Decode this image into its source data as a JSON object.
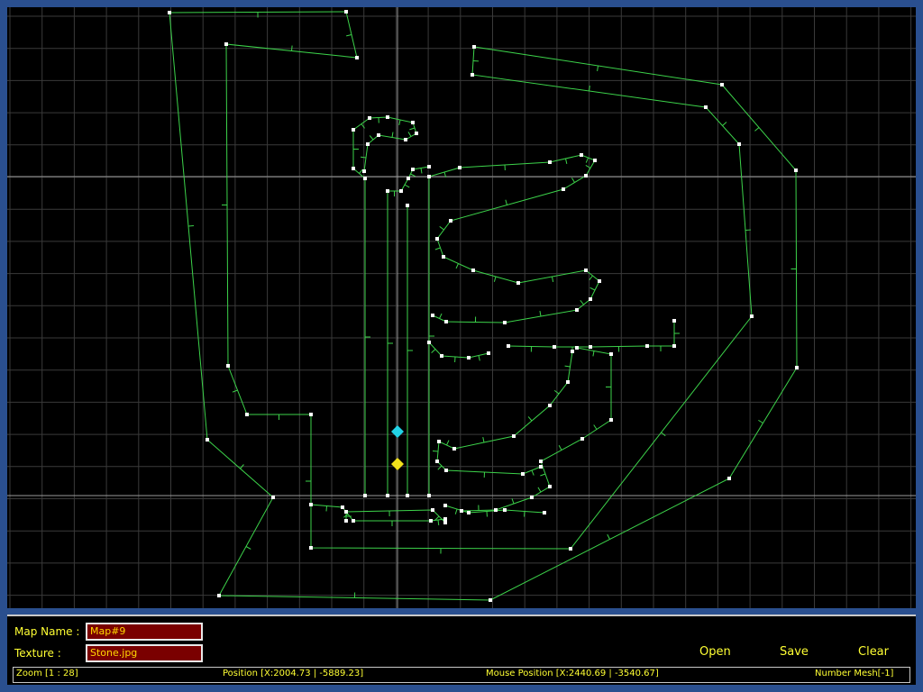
{
  "colors": {
    "window_bg": "#2a4f8f",
    "canvas_bg": "#000000",
    "grid": "#3a3a3a",
    "axis": "#9a9a9a",
    "edge": "#3cd24a",
    "vertex": "#ffffff",
    "start_marker": "#22d3e6",
    "end_marker": "#f2e21b",
    "label_text": "#ffff33",
    "field_bg": "#7a0000"
  },
  "panel": {
    "map_name_label": "Map Name :",
    "map_name_value": "Map#9",
    "texture_label": "Texture :",
    "texture_value": "Stone.jpg",
    "buttons": {
      "open": "Open",
      "save": "Save",
      "clear": "Clear"
    }
  },
  "status": {
    "zoom": "Zoom [1 : 28]",
    "position": "Position [X:2004.73 | -5889.23]",
    "mouse_position": "Mouse Position [X:2440.69 | -3540.67]",
    "number_mesh": "Number Mesh[-1]"
  }
}
